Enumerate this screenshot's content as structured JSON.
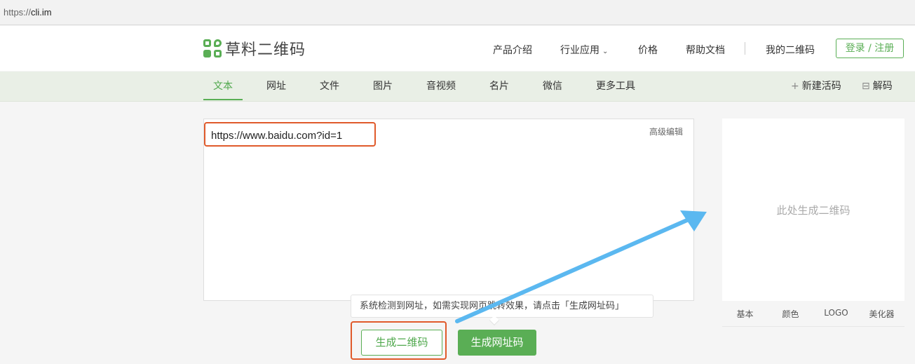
{
  "browser": {
    "url_proto": "https://",
    "url_host": "cli.im"
  },
  "header": {
    "logo_text": "草料二维码",
    "nav": [
      "产品介绍",
      "行业应用",
      "价格",
      "帮助文档",
      "我的二维码"
    ],
    "login_label": "登录 / 注册"
  },
  "tabs": [
    "文本",
    "网址",
    "文件",
    "图片",
    "音视频",
    "名片",
    "微信",
    "更多工具"
  ],
  "active_tab": "文本",
  "tools": {
    "new_live_code": "新建活码",
    "decode": "解码"
  },
  "editor": {
    "advanced_edit": "高级编辑",
    "content": "https://www.baidu.com?id=1"
  },
  "tooltip": "系统检测到网址，如需实现网页跳转效果，请点击「生成网址码」",
  "buttons": {
    "generate_qr": "生成二维码",
    "generate_url_qr": "生成网址码"
  },
  "preview": {
    "placeholder": "此处生成二维码",
    "tabs": [
      "基本",
      "颜色",
      "LOGO",
      "美化器"
    ]
  },
  "colors": {
    "brand_green": "#5aae55",
    "highlight": "#e05a2b",
    "arrow": "#5bb8f0"
  }
}
